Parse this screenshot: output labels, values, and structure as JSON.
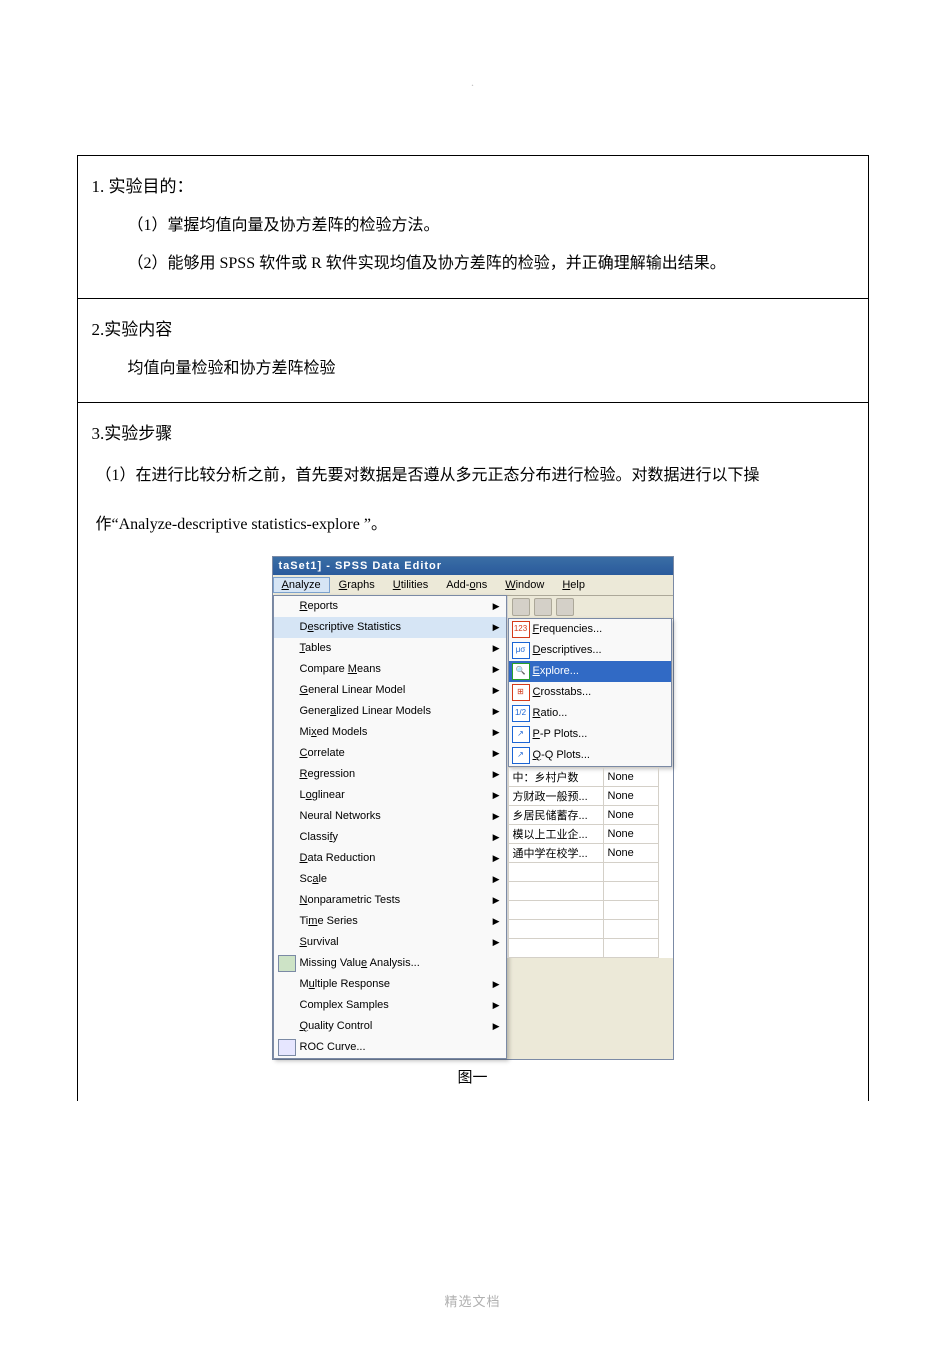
{
  "doc": {
    "top_dot": ".",
    "section1": {
      "heading": "1. 实验目的：",
      "line1": "（1）掌握均值向量及协方差阵的检验方法。",
      "line2": "（2）能够用 SPSS 软件或 R 软件实现均值及协方差阵的检验，并正确理解输出结果。"
    },
    "section2": {
      "heading": "2.实验内容",
      "line1": "均值向量检验和协方差阵检验"
    },
    "section3": {
      "heading": "3.实验步骤",
      "para_a": "（1）在进行比较分析之前，首先要对数据是否遵从多元正态分布进行检验。对数据进行以下操",
      "para_b": "作“Analyze-descriptive  statistics-explore  ”。"
    },
    "caption": "图一",
    "footer": "精选文档"
  },
  "spss": {
    "title": "taSet1] - SPSS Data Editor",
    "menubar": [
      "Analyze",
      "Graphs",
      "Utilities",
      "Add-ons",
      "Window",
      "Help"
    ],
    "menubar_underline_idx": [
      0,
      0,
      0,
      4,
      0,
      0
    ],
    "active_menu_index": 0,
    "dropdown": [
      {
        "label": "Reports",
        "u": 0,
        "arrow": true
      },
      {
        "label": "Descriptive Statistics",
        "u": 1,
        "arrow": true,
        "highlight": true
      },
      {
        "label": "Tables",
        "u": 0,
        "arrow": true
      },
      {
        "label": "Compare Means",
        "u": 8,
        "arrow": true
      },
      {
        "label": "General Linear Model",
        "u": 0,
        "arrow": true
      },
      {
        "label": "Generalized Linear Models",
        "u": 5,
        "arrow": true
      },
      {
        "label": "Mixed Models",
        "u": 2,
        "arrow": true
      },
      {
        "label": "Correlate",
        "u": 0,
        "arrow": true
      },
      {
        "label": "Regression",
        "u": 0,
        "arrow": true
      },
      {
        "label": "Loglinear",
        "u": 1,
        "arrow": true
      },
      {
        "label": "Neural Networks",
        "u": -1,
        "arrow": true
      },
      {
        "label": "Classify",
        "u": 6,
        "arrow": true
      },
      {
        "label": "Data Reduction",
        "u": 0,
        "arrow": true
      },
      {
        "label": "Scale",
        "u": 2,
        "arrow": true
      },
      {
        "label": "Nonparametric Tests",
        "u": 0,
        "arrow": true
      },
      {
        "label": "Time Series",
        "u": 2,
        "arrow": true
      },
      {
        "label": "Survival",
        "u": 0,
        "arrow": true
      },
      {
        "label": "Missing Value Analysis...",
        "u": 12,
        "arrow": false,
        "icon": "mva"
      },
      {
        "label": "Multiple Response",
        "u": 1,
        "arrow": true
      },
      {
        "label": "Complex Samples",
        "u": -1,
        "arrow": true
      },
      {
        "label": "Quality Control",
        "u": 0,
        "arrow": true
      },
      {
        "label": "ROC Curve...",
        "u": -1,
        "arrow": false,
        "icon": "roc"
      }
    ],
    "submenu": [
      {
        "label": "Frequencies...",
        "u": 0,
        "icon_color": "#d43a1a",
        "icon_text": "123"
      },
      {
        "label": "Descriptives...",
        "u": 0,
        "icon_color": "#1a64d4",
        "icon_text": "μσ"
      },
      {
        "label": "Explore...",
        "u": 0,
        "icon_color": "#2aa02a",
        "icon_text": "🔍",
        "highlight": true
      },
      {
        "label": "Crosstabs...",
        "u": 0,
        "icon_color": "#d43a1a",
        "icon_text": "⊞"
      },
      {
        "label": "Ratio...",
        "u": 0,
        "icon_color": "#1a64d4",
        "icon_text": "1/2"
      },
      {
        "label": "P-P Plots...",
        "u": 0,
        "icon_color": "#1a64d4",
        "icon_text": "↗"
      },
      {
        "label": "Q-Q Plots...",
        "u": 0,
        "icon_color": "#1a64d4",
        "icon_text": "↗"
      }
    ],
    "grid_rows": [
      {
        "label": "中：乡村户数",
        "val": "None"
      },
      {
        "label": "方财政一般预...",
        "val": "None"
      },
      {
        "label": "乡居民储蓄存...",
        "val": "None"
      },
      {
        "label": "模以上工业企...",
        "val": "None"
      },
      {
        "label": "通中学在校学...",
        "val": "None"
      }
    ]
  }
}
